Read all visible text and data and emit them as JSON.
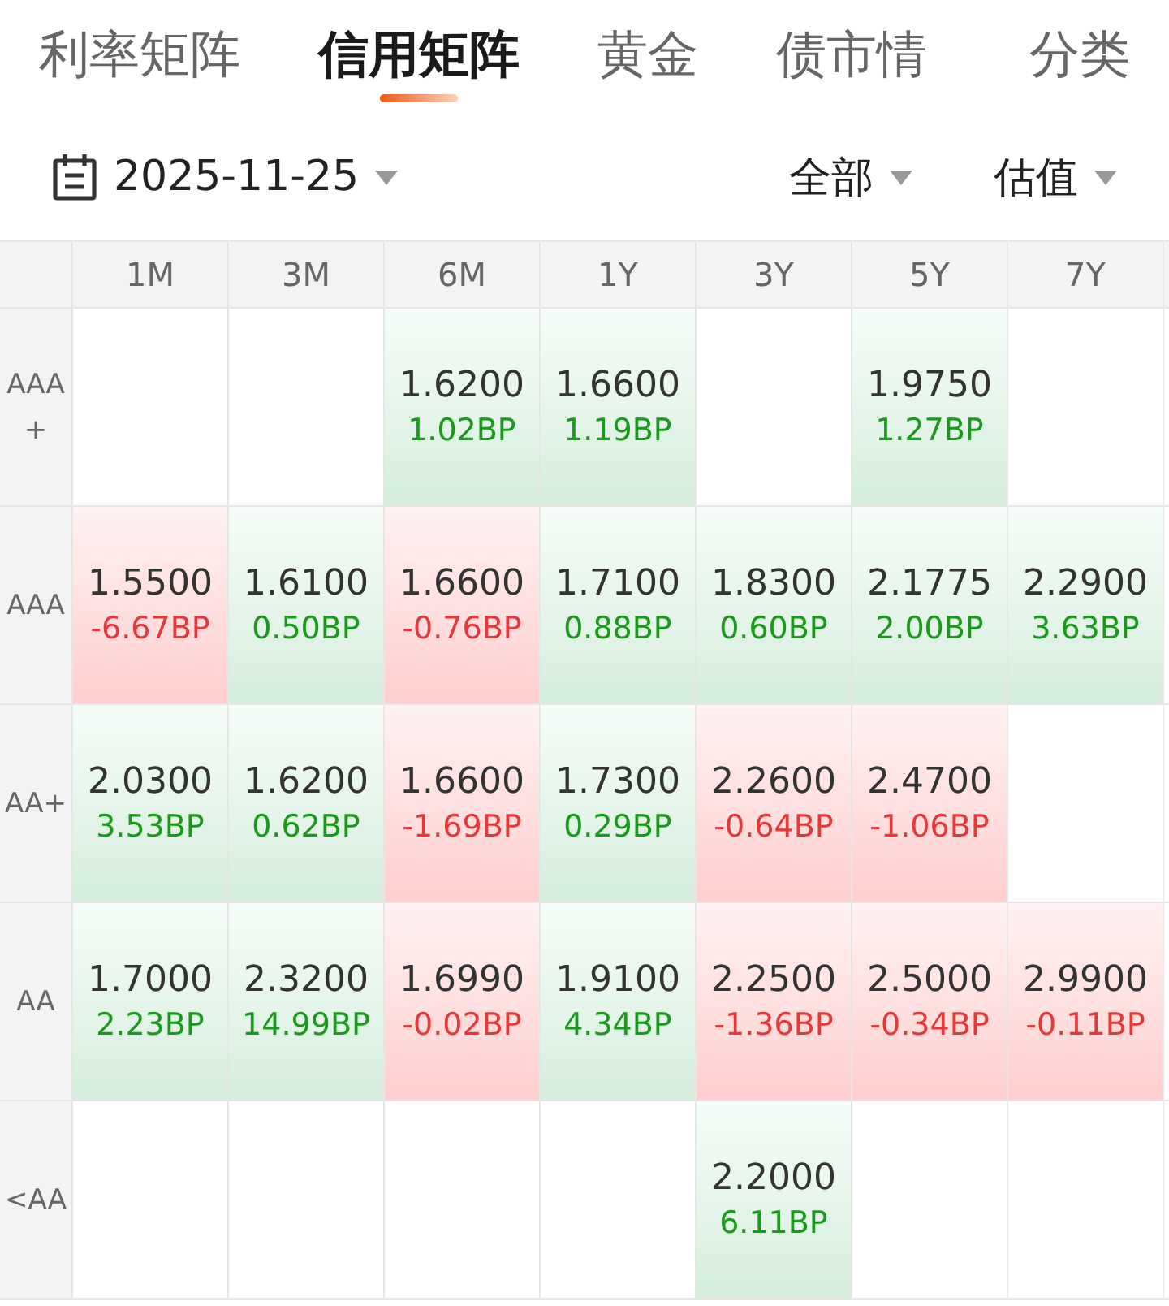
{
  "tabs": [
    {
      "label": "利率矩阵",
      "selected": false
    },
    {
      "label": "信用矩阵",
      "selected": true
    },
    {
      "label": "黄金",
      "selected": false
    },
    {
      "label": "债市情",
      "selected": false
    }
  ],
  "category_button": "分类",
  "toolbar": {
    "date": "2025-11-25",
    "filter": "全部",
    "type": "估值"
  },
  "table": {
    "columns": [
      "1M",
      "3M",
      "6M",
      "1Y",
      "3Y",
      "5Y",
      "7Y"
    ],
    "rows": [
      {
        "label": "AAA +",
        "cells": [
          {
            "kind": "empty"
          },
          {
            "kind": "empty"
          },
          {
            "kind": "up",
            "value": "1.6200",
            "change": "1.02BP"
          },
          {
            "kind": "up",
            "value": "1.6600",
            "change": "1.19BP"
          },
          {
            "kind": "empty"
          },
          {
            "kind": "up",
            "value": "1.9750",
            "change": "1.27BP"
          },
          {
            "kind": "empty"
          }
        ]
      },
      {
        "label": "AAA",
        "cells": [
          {
            "kind": "down",
            "value": "1.5500",
            "change": "-6.67BP"
          },
          {
            "kind": "up",
            "value": "1.6100",
            "change": "0.50BP"
          },
          {
            "kind": "down",
            "value": "1.6600",
            "change": "-0.76BP"
          },
          {
            "kind": "up",
            "value": "1.7100",
            "change": "0.88BP"
          },
          {
            "kind": "up",
            "value": "1.8300",
            "change": "0.60BP"
          },
          {
            "kind": "up",
            "value": "2.1775",
            "change": "2.00BP"
          },
          {
            "kind": "up",
            "value": "2.2900",
            "change": "3.63BP"
          }
        ]
      },
      {
        "label": "AA+",
        "cells": [
          {
            "kind": "up",
            "value": "2.0300",
            "change": "3.53BP"
          },
          {
            "kind": "up",
            "value": "1.6200",
            "change": "0.62BP"
          },
          {
            "kind": "down",
            "value": "1.6600",
            "change": "-1.69BP"
          },
          {
            "kind": "up",
            "value": "1.7300",
            "change": "0.29BP"
          },
          {
            "kind": "down",
            "value": "2.2600",
            "change": "-0.64BP"
          },
          {
            "kind": "down",
            "value": "2.4700",
            "change": "-1.06BP"
          },
          {
            "kind": "empty"
          }
        ]
      },
      {
        "label": "AA",
        "cells": [
          {
            "kind": "up",
            "value": "1.7000",
            "change": "2.23BP"
          },
          {
            "kind": "up",
            "value": "2.3200",
            "change": "14.99BP"
          },
          {
            "kind": "down",
            "value": "1.6990",
            "change": "-0.02BP"
          },
          {
            "kind": "up",
            "value": "1.9100",
            "change": "4.34BP"
          },
          {
            "kind": "down",
            "value": "2.2500",
            "change": "-1.36BP"
          },
          {
            "kind": "down",
            "value": "2.5000",
            "change": "-0.34BP"
          },
          {
            "kind": "down",
            "value": "2.9900",
            "change": "-0.11BP"
          }
        ]
      },
      {
        "label": "<AA",
        "cells": [
          {
            "kind": "empty"
          },
          {
            "kind": "empty"
          },
          {
            "kind": "empty"
          },
          {
            "kind": "empty"
          },
          {
            "kind": "up",
            "value": "2.2000",
            "change": "6.11BP"
          },
          {
            "kind": "empty"
          },
          {
            "kind": "empty"
          }
        ]
      }
    ]
  }
}
